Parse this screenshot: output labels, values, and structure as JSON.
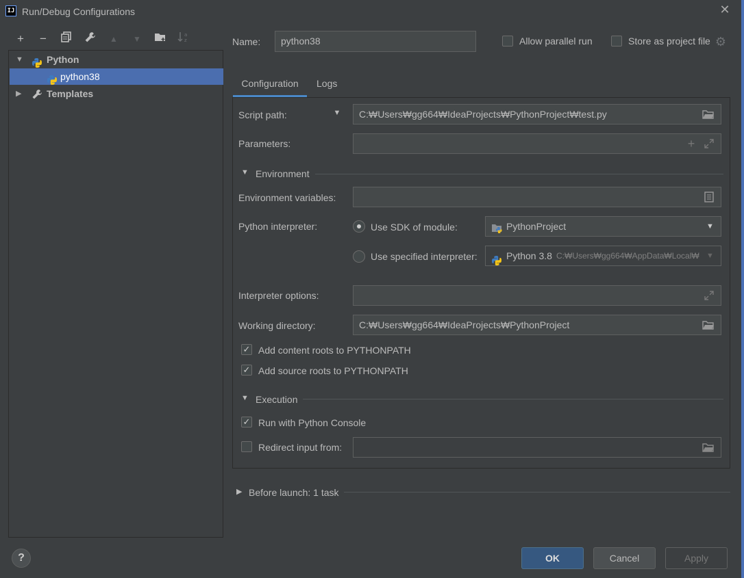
{
  "window": {
    "title": "Run/Debug Configurations",
    "app_icon_text": "IJ"
  },
  "toolbar": {
    "add": "+",
    "remove": "−",
    "copy": "⧉",
    "edit": "🔧",
    "up": "▲",
    "down": "▼",
    "folder": "📁",
    "sort": "↓a"
  },
  "tree": {
    "items": [
      {
        "label": "Python"
      },
      {
        "label": "python38"
      },
      {
        "label": "Templates"
      }
    ]
  },
  "header": {
    "name_label": "Name:",
    "name_value": "python38",
    "allow_parallel_label": "Allow parallel run",
    "store_as_project_label": "Store as project file"
  },
  "tabs": [
    {
      "label": "Configuration"
    },
    {
      "label": "Logs"
    }
  ],
  "config": {
    "script_path_label": "Script path:",
    "script_path_value": "C:₩Users₩gg664₩IdeaProjects₩PythonProject₩test.py",
    "parameters_label": "Parameters:",
    "parameters_value": "",
    "environment_section": "Environment",
    "env_vars_label": "Environment variables:",
    "env_vars_value": "",
    "interpreter_label": "Python interpreter:",
    "use_sdk_label": "Use SDK of module:",
    "sdk_module_value": "PythonProject",
    "use_specified_label": "Use specified interpreter:",
    "specified_interpreter_name": "Python 3.8",
    "specified_interpreter_path": "C:₩Users₩gg664₩AppData₩Local₩",
    "interpreter_options_label": "Interpreter options:",
    "interpreter_options_value": "",
    "working_dir_label": "Working directory:",
    "working_dir_value": "C:₩Users₩gg664₩IdeaProjects₩PythonProject",
    "add_content_roots_label": "Add content roots to PYTHONPATH",
    "add_source_roots_label": "Add source roots to PYTHONPATH",
    "execution_section": "Execution",
    "run_console_label": "Run with Python Console",
    "redirect_input_label": "Redirect input from:",
    "redirect_input_value": ""
  },
  "before_launch": {
    "label": "Before launch: 1 task"
  },
  "buttons": {
    "ok": "OK",
    "cancel": "Cancel",
    "apply": "Apply",
    "help": "?"
  },
  "colors": {
    "background": "#3c3f41",
    "selection": "#4b6eaf",
    "accent_tab": "#4a88c7",
    "ok_button": "#365880"
  }
}
